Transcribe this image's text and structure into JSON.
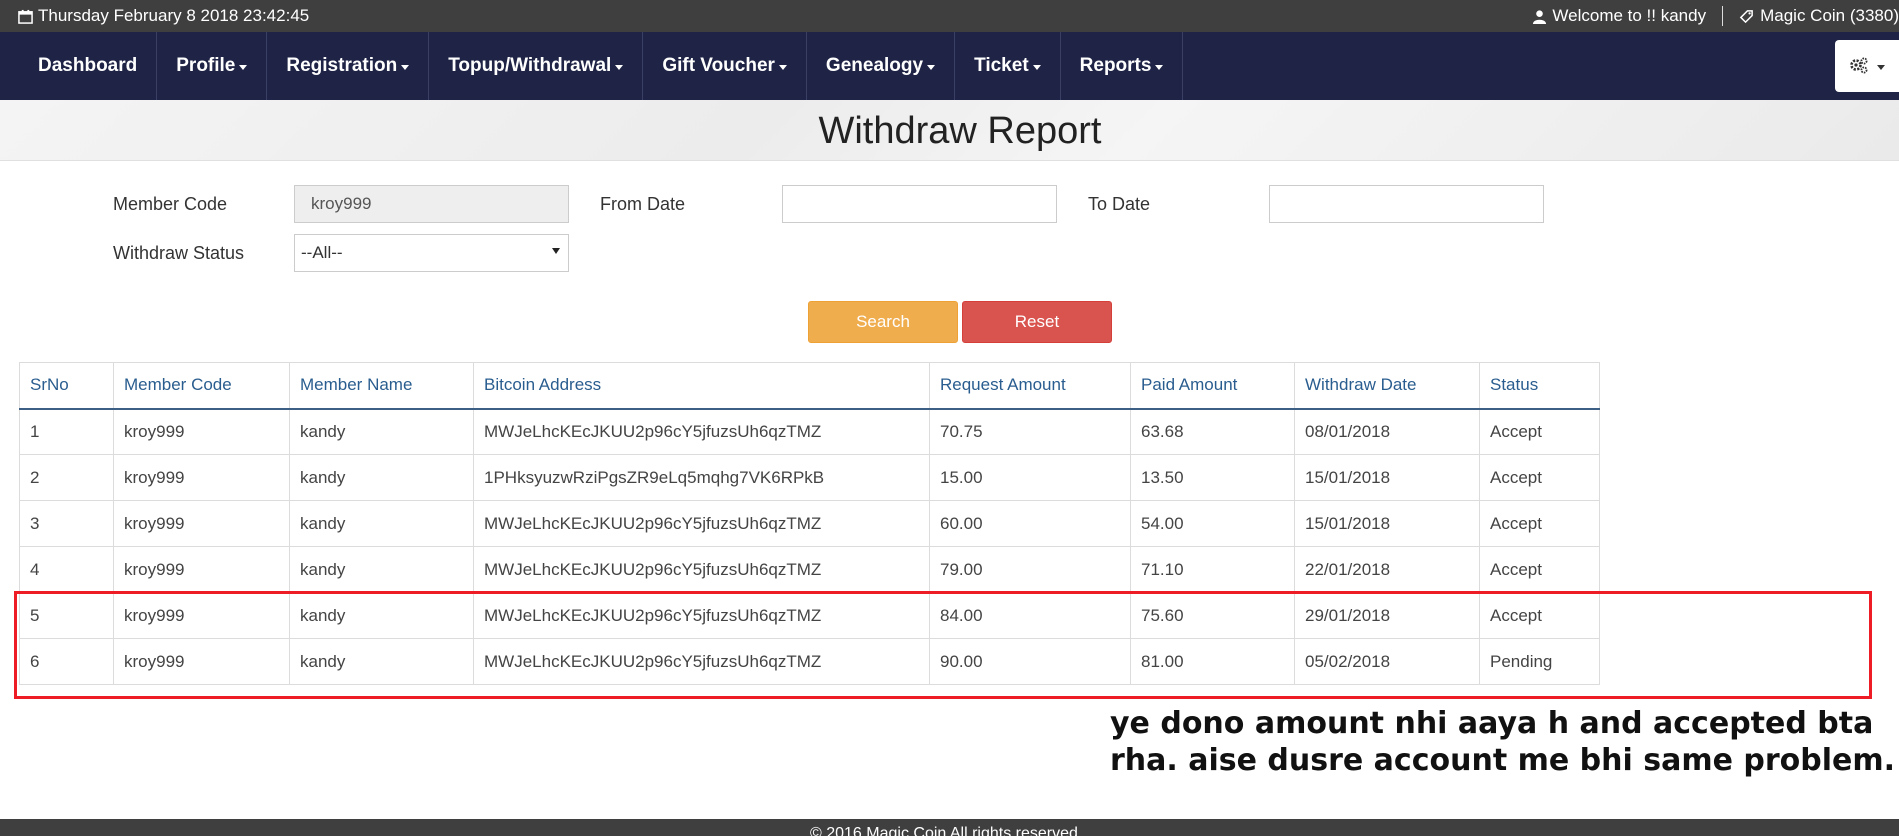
{
  "topbar": {
    "datetime": "Thursday February 8 2018 23:42:45",
    "welcome": "Welcome to !! kandy",
    "coin": "Magic Coin (3380)"
  },
  "nav": {
    "items": [
      {
        "label": "Dashboard",
        "dropdown": false
      },
      {
        "label": "Profile",
        "dropdown": true
      },
      {
        "label": "Registration",
        "dropdown": true
      },
      {
        "label": "Topup/Withdrawal",
        "dropdown": true
      },
      {
        "label": "Gift Voucher",
        "dropdown": true
      },
      {
        "label": "Genealogy",
        "dropdown": true
      },
      {
        "label": "Ticket",
        "dropdown": true
      },
      {
        "label": "Reports",
        "dropdown": true
      }
    ]
  },
  "page": {
    "title": "Withdraw Report"
  },
  "filters": {
    "member_code_label": "Member Code",
    "member_code_value": "kroy999",
    "from_date_label": "From Date",
    "from_date_value": "",
    "to_date_label": "To Date",
    "to_date_value": "",
    "status_label": "Withdraw Status",
    "status_value": "--All--",
    "search_label": "Search",
    "reset_label": "Reset"
  },
  "table": {
    "headers": [
      "SrNo",
      "Member Code",
      "Member Name",
      "Bitcoin Address",
      "Request Amount",
      "Paid Amount",
      "Withdraw Date",
      "Status"
    ],
    "rows": [
      [
        "1",
        "kroy999",
        "kandy",
        "MWJeLhcKEcJKUU2p96cY5jfuzsUh6qzTMZ",
        "70.75",
        "63.68",
        "08/01/2018",
        "Accept"
      ],
      [
        "2",
        "kroy999",
        "kandy",
        "1PHksyuzwRziPgsZR9eLq5mqhg7VK6RPkB",
        "15.00",
        "13.50",
        "15/01/2018",
        "Accept"
      ],
      [
        "3",
        "kroy999",
        "kandy",
        "MWJeLhcKEcJKUU2p96cY5jfuzsUh6qzTMZ",
        "60.00",
        "54.00",
        "15/01/2018",
        "Accept"
      ],
      [
        "4",
        "kroy999",
        "kandy",
        "MWJeLhcKEcJKUU2p96cY5jfuzsUh6qzTMZ",
        "79.00",
        "71.10",
        "22/01/2018",
        "Accept"
      ],
      [
        "5",
        "kroy999",
        "kandy",
        "MWJeLhcKEcJKUU2p96cY5jfuzsUh6qzTMZ",
        "84.00",
        "75.60",
        "29/01/2018",
        "Accept"
      ],
      [
        "6",
        "kroy999",
        "kandy",
        "MWJeLhcKEcJKUU2p96cY5jfuzsUh6qzTMZ",
        "90.00",
        "81.00",
        "05/02/2018",
        "Pending"
      ]
    ]
  },
  "annotation": {
    "line1": "ye dono amount nhi aaya h and accepted bta",
    "line2": "rha. aise dusre account me bhi same problem."
  },
  "footer": {
    "text": "© 2016 Magic Coin All rights reserved"
  },
  "colors": {
    "navbar": "#1f2446",
    "topbar": "#3f3f3f",
    "search": "#f0ad4e",
    "reset": "#d9534f",
    "highlight": "#ee1c24",
    "header_text": "#2a5d8f"
  }
}
